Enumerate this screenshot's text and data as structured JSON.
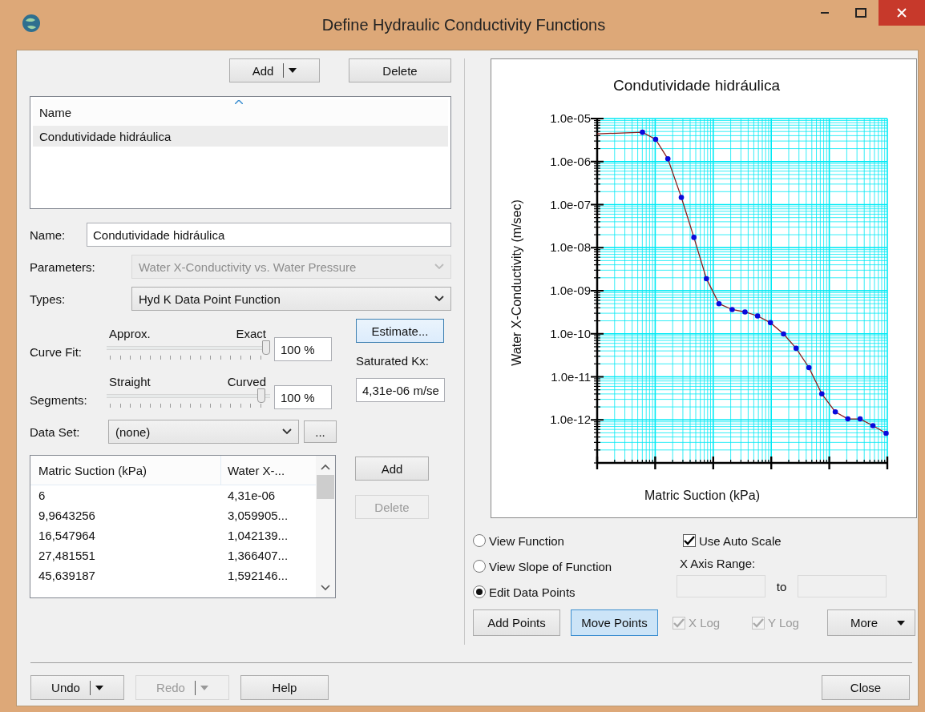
{
  "window": {
    "title": "Define Hydraulic Conductivity Functions"
  },
  "top_buttons": [
    {
      "label": "Add",
      "kind": "split"
    },
    {
      "label": "Delete",
      "kind": "plain"
    }
  ],
  "function_list": {
    "columns": [
      "Name"
    ],
    "rows": [
      {
        "name": "Condutividade hidráulica",
        "selected": true
      }
    ]
  },
  "name_field": {
    "label": "Name:",
    "value": "Condutividade hidráulica"
  },
  "selects": [
    {
      "label": "Parameters:",
      "value": "Water X-Conductivity vs. Water Pressure",
      "disabled": true
    },
    {
      "label": "Types:",
      "value": "Hyd K Data Point Function",
      "disabled": false
    }
  ],
  "sliders": [
    {
      "label": "Curve Fit:",
      "min_label": "Approx.",
      "max_label": "Exact",
      "level": 1,
      "value": "100 %"
    },
    {
      "label": "Segments:",
      "min_label": "Straight",
      "max_label": "Curved",
      "level": 0.97,
      "value": "100 %"
    }
  ],
  "estimate_button": {
    "label": "Estimate...",
    "focused": true
  },
  "saturated_kx": {
    "label": "Saturated Kx:",
    "value": "4,31e-06 m/se"
  },
  "data_set": {
    "label": "Data Set:",
    "value": "(none)",
    "browse": "..."
  },
  "data_table": {
    "columns": [
      "Matric Suction (kPa)",
      "Water X-..."
    ],
    "rows": [
      [
        "6",
        "4,31e-06"
      ],
      [
        "9,9643256",
        "3,059905..."
      ],
      [
        "16,547964",
        "1,042139..."
      ],
      [
        "27,481551",
        "1,366407..."
      ],
      [
        "45,639187",
        "1,592146..."
      ]
    ]
  },
  "table_buttons": [
    {
      "label": "Add",
      "disabled": false
    },
    {
      "label": "Delete",
      "disabled": true
    }
  ],
  "chart": {
    "title": "Condutividade hidráulica",
    "ylabel": "Water X-Conductivity (m/sec)",
    "xlabel": "Matric Suction (kPa)",
    "ytick_labels": [
      "1.0e-05",
      "1.0e-06",
      "1.0e-07",
      "1.0e-08",
      "1.0e-09",
      "1.0e-10",
      "1.0e-11",
      "1.0e-12"
    ]
  },
  "view_options": [
    {
      "label": "View Function",
      "selected": false
    },
    {
      "label": "View Slope of Function",
      "selected": false
    },
    {
      "label": "Edit Data Points",
      "selected": true
    }
  ],
  "auto_scale": {
    "label": "Use Auto Scale",
    "checked": true
  },
  "x_axis_range": {
    "label": "X Axis Range:",
    "separator": "to",
    "disabled": true
  },
  "chart_buttons": [
    {
      "label": "Add Points",
      "pressed": false
    },
    {
      "label": "Move Points",
      "pressed": true
    }
  ],
  "log_options": [
    {
      "label": "X Log",
      "checked": true,
      "disabled": true
    },
    {
      "label": "Y Log",
      "checked": true,
      "disabled": true
    }
  ],
  "more_button": {
    "label": "More"
  },
  "footer_buttons": [
    {
      "label": "Undo",
      "kind": "split",
      "disabled": false
    },
    {
      "label": "Redo",
      "kind": "split",
      "disabled": true
    },
    {
      "label": "Help",
      "kind": "plain",
      "disabled": false
    }
  ],
  "close_button": {
    "label": "Close"
  }
}
